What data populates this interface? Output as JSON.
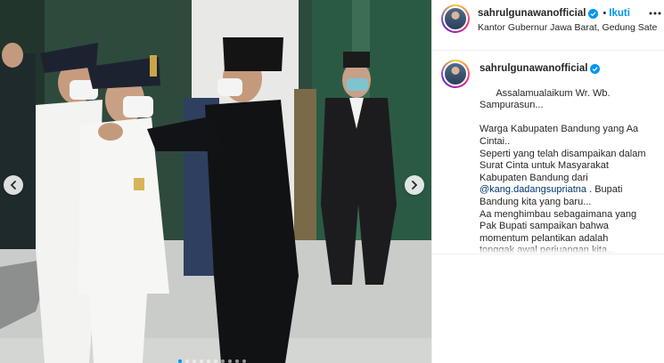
{
  "post": {
    "username": "sahrulgunawanofficial",
    "follow_label": "Ikuti",
    "separator": "•",
    "location": "Kantor Gubernur Jawa Barat, Gedung Sate",
    "caption_lines": [
      "Assalamualaikum Wr. Wb.",
      "Sampurasun...",
      "",
      "Warga Kabupaten Bandung yang Aa",
      "Cintai..",
      "Seperti yang telah disampaikan dalam",
      "Surat Cinta untuk Masyarakat",
      "Kabupaten Bandung dari"
    ],
    "mention": "@kang.dadangsupriatna",
    "caption_after_mention": " . Bupati",
    "caption_lines_2": [
      "Bandung kita yang baru...",
      "Aa menghimbau sebagaimana yang",
      "Pak Bupati sampaikan bahwa",
      "momentum pelantikan adalah",
      "tonggak awal perjuangan kita..."
    ]
  },
  "carousel": {
    "dot_count": 10,
    "active_index": 0
  },
  "icons": {
    "verified": "verified-badge-icon",
    "prev": "chevron-left-icon",
    "next": "chevron-right-icon",
    "more": "more-options-icon"
  },
  "colors": {
    "accent": "#0095f6",
    "verified": "#0095f6",
    "mention": "#00376b"
  }
}
